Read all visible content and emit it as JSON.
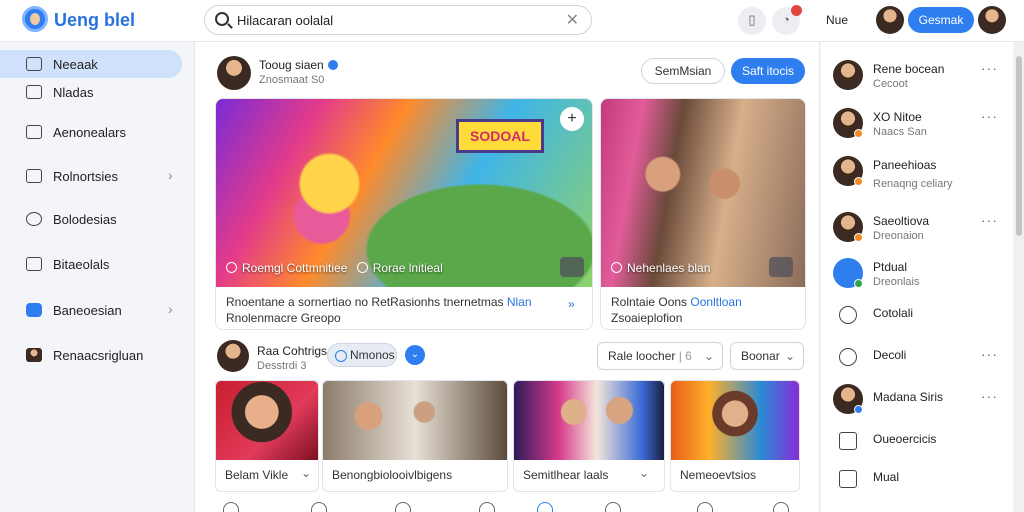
{
  "app": {
    "title": "Ueng blel"
  },
  "search": {
    "query": "Hilacaran oolalal"
  },
  "topbar": {
    "link": "Nue",
    "primary_button": "Gesmak"
  },
  "sidebar": {
    "items": [
      {
        "label": "Neeaak",
        "icon": "edit-icon",
        "active": true
      },
      {
        "label": "Nladas",
        "icon": "inbox-icon"
      },
      {
        "label": "Aenonealars",
        "icon": "folder-icon"
      },
      {
        "label": "Rolnortsies",
        "icon": "mail-icon",
        "chevron": true
      },
      {
        "label": "Bolodesias",
        "icon": "clock-icon"
      },
      {
        "label": "Bitaeolals",
        "icon": "calendar-icon"
      },
      {
        "label": "Baneoesian",
        "icon": "puzzle-icon",
        "chevron": true
      },
      {
        "label": "Renaacsrigluan",
        "icon": "person-icon"
      }
    ]
  },
  "post1": {
    "author": "Tooug siaen",
    "meta": "Znosmaat S0",
    "buttons": {
      "outline": "SemMsian",
      "primary": "Saft itocis"
    },
    "card_left": {
      "sign": "SODOAL",
      "caption": "Roemgl Cottmnitiee",
      "caption2": "Rorae lnitieal",
      "text": "Rnoentane a sornertiao no RetRasionhs tnernetmas",
      "link": "Nlan",
      "text2": "Rnolenmacre Greopo"
    },
    "card_right": {
      "caption": "Nehenlaes blan",
      "text": "Rolntaie Oons",
      "link": "Oonltloan",
      "text2": "Zsoaieplofion"
    }
  },
  "post2": {
    "author": "Raa Cohtrigs",
    "meta": "Desstrdi 3",
    "pill": "Nmonos",
    "dropdowns": [
      "Rale loocher",
      "Boonar"
    ],
    "dropdown_sep": "| 6",
    "thumbs": [
      {
        "label": "Belam Vikle",
        "chevron": true
      },
      {
        "label": "Benongbiolooivlbigens",
        "chevron": false
      },
      {
        "label": "Semitlhear laals",
        "chevron": true
      },
      {
        "label": "Nemeoevtsios",
        "chevron": false
      }
    ]
  },
  "rightbar": {
    "items": [
      {
        "name": "Rene bocean",
        "sub": "Cecoot",
        "badge": "#ffffff",
        "dots": true,
        "type": "avatar"
      },
      {
        "name": "XO Nitoe",
        "sub": "Naacs San",
        "badge": "#f08a24",
        "dots": true,
        "type": "avatar"
      },
      {
        "name": "Paneehioas",
        "sub": "Renaqng celiary",
        "badge": "#f08a24",
        "dots": false,
        "type": "avatar"
      },
      {
        "name": "Saeoltiova",
        "sub": "Dreonaion",
        "badge": "#f08a24",
        "dots": true,
        "type": "avatar"
      },
      {
        "name": "Ptdual",
        "sub": "Dreonlais",
        "badge": "#2ea44f",
        "dots": false,
        "type": "blue"
      },
      {
        "name": "Cotolali",
        "sub": "",
        "badge": "",
        "dots": false,
        "type": "icon"
      },
      {
        "name": "Decoli",
        "sub": "",
        "badge": "",
        "dots": true,
        "type": "icon"
      },
      {
        "name": "Madana Siris",
        "sub": "",
        "badge": "#2e7ef0",
        "dots": true,
        "type": "avatar"
      },
      {
        "name": "Oueoercicis",
        "sub": "",
        "badge": "",
        "dots": false,
        "type": "icon"
      },
      {
        "name": "Mual",
        "sub": "",
        "badge": "",
        "dots": false,
        "type": "icon"
      }
    ]
  },
  "colors": {
    "accent": "#2e7ef0",
    "active_nav": "#cfe1fb"
  }
}
